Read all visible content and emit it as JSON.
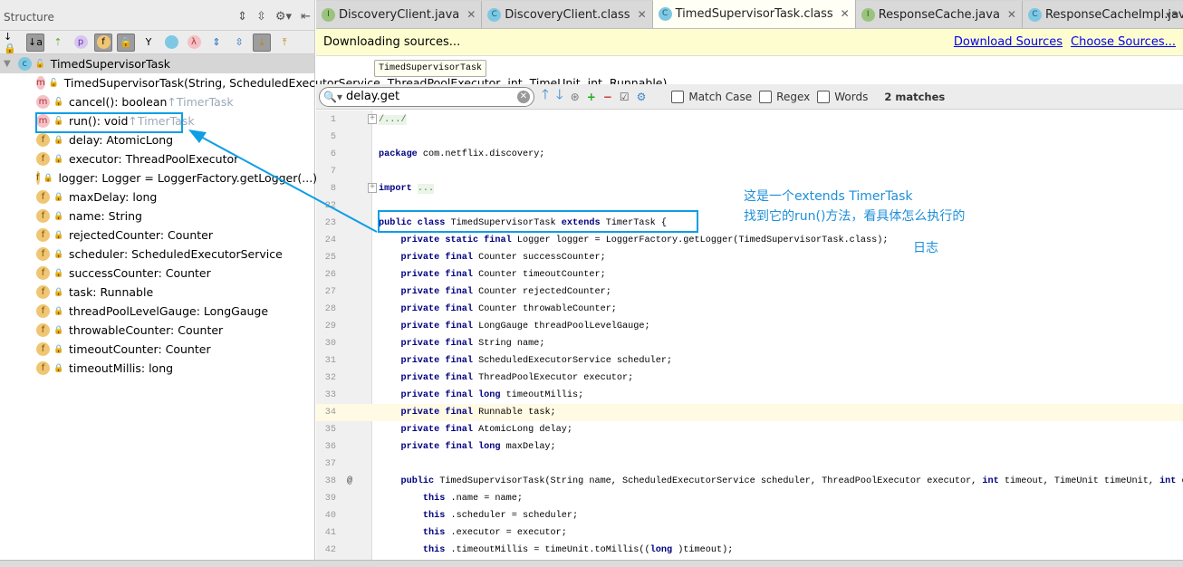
{
  "structure": {
    "title": "Structure",
    "root": "TimedSupervisorTask",
    "items": [
      {
        "kind": "m",
        "label": "TimedSupervisorTask(String, ScheduledExecutorService, ThreadPoolExecutor, int, TimeUnit, int, Runnable)",
        "inherit": ""
      },
      {
        "kind": "m",
        "label": "cancel(): boolean ",
        "inherit": "↑TimerTask"
      },
      {
        "kind": "m",
        "label": "run(): void ",
        "inherit": "↑TimerTask"
      },
      {
        "kind": "f",
        "label": "delay: AtomicLong",
        "inherit": ""
      },
      {
        "kind": "f",
        "label": "executor: ThreadPoolExecutor",
        "inherit": ""
      },
      {
        "kind": "f",
        "label": "logger: Logger = LoggerFactory.getLogger(...)",
        "inherit": ""
      },
      {
        "kind": "f",
        "label": "maxDelay: long",
        "inherit": ""
      },
      {
        "kind": "f",
        "label": "name: String",
        "inherit": ""
      },
      {
        "kind": "f",
        "label": "rejectedCounter: Counter",
        "inherit": ""
      },
      {
        "kind": "f",
        "label": "scheduler: ScheduledExecutorService",
        "inherit": ""
      },
      {
        "kind": "f",
        "label": "successCounter: Counter",
        "inherit": ""
      },
      {
        "kind": "f",
        "label": "task: Runnable",
        "inherit": ""
      },
      {
        "kind": "f",
        "label": "threadPoolLevelGauge: LongGauge",
        "inherit": ""
      },
      {
        "kind": "f",
        "label": "throwableCounter: Counter",
        "inherit": ""
      },
      {
        "kind": "f",
        "label": "timeoutCounter: Counter",
        "inherit": ""
      },
      {
        "kind": "f",
        "label": "timeoutMillis: long",
        "inherit": ""
      }
    ]
  },
  "tabs": [
    {
      "label": "DiscoveryClient.java",
      "icon": "interface",
      "active": false
    },
    {
      "label": "DiscoveryClient.class",
      "icon": "class",
      "active": false
    },
    {
      "label": "TimedSupervisorTask.class",
      "icon": "class",
      "active": true
    },
    {
      "label": "ResponseCache.java",
      "icon": "interface",
      "active": false
    },
    {
      "label": "ResponseCacheImpl.java",
      "icon": "class",
      "active": false
    }
  ],
  "banner": {
    "text": "Downloading sources...",
    "download": "Download Sources",
    "choose": "Choose Sources..."
  },
  "tooltip": "TimedSupervisorTask",
  "search": {
    "value": "delay.get",
    "match_case": "Match Case",
    "regex": "Regex",
    "words": "Words",
    "matches": "2 matches"
  },
  "code": [
    {
      "n": "1",
      "t": [
        [
          "fold",
          "/.../"
        ]
      ]
    },
    {
      "n": "5",
      "t": []
    },
    {
      "n": "6",
      "t": [
        [
          "kw",
          "package"
        ],
        [
          "",
          "com.netflix.discovery;"
        ]
      ]
    },
    {
      "n": "7",
      "t": []
    },
    {
      "n": "8",
      "t": [
        [
          "kw",
          "import"
        ],
        [
          "",
          ""
        ],
        [
          "fold",
          "..."
        ]
      ]
    },
    {
      "n": "22",
      "t": []
    },
    {
      "n": "23",
      "t": [
        [
          "kw",
          "public class"
        ],
        [
          "",
          "TimedSupervisorTask "
        ],
        [
          "kw",
          "extends"
        ],
        [
          "",
          "TimerTask {"
        ]
      ]
    },
    {
      "n": "24",
      "t": [
        [
          "",
          "    "
        ],
        [
          "kw",
          "private static final"
        ],
        [
          "",
          "Logger logger = LoggerFactory.getLogger(TimedSupervisorTask.class);"
        ]
      ]
    },
    {
      "n": "25",
      "t": [
        [
          "",
          "    "
        ],
        [
          "kw",
          "private final"
        ],
        [
          "",
          "Counter successCounter;"
        ]
      ]
    },
    {
      "n": "26",
      "t": [
        [
          "",
          "    "
        ],
        [
          "kw",
          "private final"
        ],
        [
          "",
          "Counter timeoutCounter;"
        ]
      ]
    },
    {
      "n": "27",
      "t": [
        [
          "",
          "    "
        ],
        [
          "kw",
          "private final"
        ],
        [
          "",
          "Counter rejectedCounter;"
        ]
      ]
    },
    {
      "n": "28",
      "t": [
        [
          "",
          "    "
        ],
        [
          "kw",
          "private final"
        ],
        [
          "",
          "Counter throwableCounter;"
        ]
      ]
    },
    {
      "n": "29",
      "t": [
        [
          "",
          "    "
        ],
        [
          "kw",
          "private final"
        ],
        [
          "",
          "LongGauge threadPoolLevelGauge;"
        ]
      ]
    },
    {
      "n": "30",
      "t": [
        [
          "",
          "    "
        ],
        [
          "kw",
          "private final"
        ],
        [
          "",
          "String name;"
        ]
      ]
    },
    {
      "n": "31",
      "t": [
        [
          "",
          "    "
        ],
        [
          "kw",
          "private final"
        ],
        [
          "",
          "ScheduledExecutorService scheduler;"
        ]
      ]
    },
    {
      "n": "32",
      "t": [
        [
          "",
          "    "
        ],
        [
          "kw",
          "private final"
        ],
        [
          "",
          "ThreadPoolExecutor executor;"
        ]
      ]
    },
    {
      "n": "33",
      "t": [
        [
          "",
          "    "
        ],
        [
          "kw",
          "private final long"
        ],
        [
          "",
          "timeoutMillis;"
        ]
      ]
    },
    {
      "n": "34",
      "t": [
        [
          "",
          "    "
        ],
        [
          "kw",
          "private final"
        ],
        [
          "",
          "Runnable task;"
        ]
      ]
    },
    {
      "n": "35",
      "t": [
        [
          "",
          "    "
        ],
        [
          "kw",
          "private final"
        ],
        [
          "",
          "AtomicLong delay;"
        ]
      ]
    },
    {
      "n": "36",
      "t": [
        [
          "",
          "    "
        ],
        [
          "kw",
          "private final long"
        ],
        [
          "",
          "maxDelay;"
        ]
      ]
    },
    {
      "n": "37",
      "t": []
    },
    {
      "n": "38",
      "t": [
        [
          "",
          "    "
        ],
        [
          "kw",
          "public"
        ],
        [
          "",
          "TimedSupervisorTask(String name, ScheduledExecutorService scheduler, ThreadPoolExecutor executor, "
        ],
        [
          "kw",
          "int"
        ],
        [
          "",
          "timeout, TimeUnit timeUnit, "
        ],
        [
          "kw",
          "int"
        ],
        [
          "",
          "e"
        ]
      ]
    },
    {
      "n": "39",
      "t": [
        [
          "",
          "        "
        ],
        [
          "kw",
          "this"
        ],
        [
          "",
          ".name = name;"
        ]
      ]
    },
    {
      "n": "40",
      "t": [
        [
          "",
          "        "
        ],
        [
          "kw",
          "this"
        ],
        [
          "",
          ".scheduler = scheduler;"
        ]
      ]
    },
    {
      "n": "41",
      "t": [
        [
          "",
          "        "
        ],
        [
          "kw",
          "this"
        ],
        [
          "",
          ".executor = executor;"
        ]
      ]
    },
    {
      "n": "42",
      "t": [
        [
          "",
          "        "
        ],
        [
          "kw",
          "this"
        ],
        [
          "",
          ".timeoutMillis = timeUnit.toMillis(("
        ],
        [
          "kw",
          "long"
        ],
        [
          "",
          ")timeout);"
        ]
      ]
    }
  ],
  "annotations": {
    "line1": "这是一个extends TimerTask",
    "line2": "找到它的run()方法，看具体怎么执行的",
    "line3": "日志"
  },
  "colors": {
    "annotation": "#0e9ee6",
    "keyword": "#000080",
    "banner": "#fdfdd0"
  }
}
